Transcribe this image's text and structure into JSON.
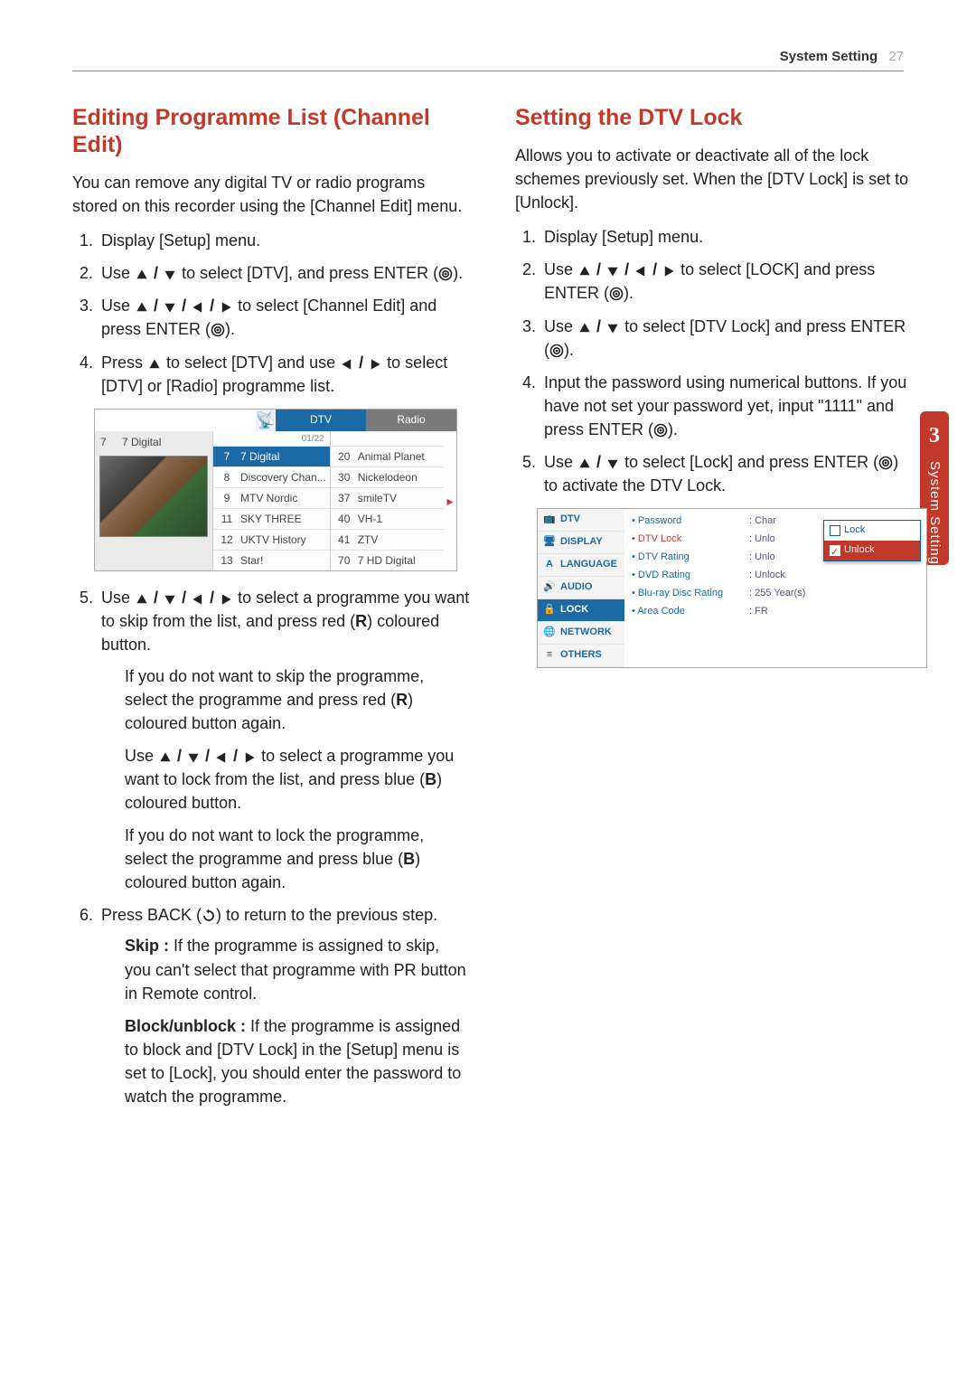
{
  "running_head": {
    "section": "System Setting",
    "page": "27"
  },
  "side_tab": {
    "num": "3",
    "label": "System Setting"
  },
  "left": {
    "title": "Editing Programme List (Channel Edit)",
    "intro": "You can remove any digital TV or radio programs stored on this recorder using the [Channel Edit] menu.",
    "steps_a": [
      "Display [Setup] menu.",
      "Use [UD] to select [DTV], and press ENTER ([ENTER]).",
      "Use [UDLR] to select [Channel Edit] and press ENTER ([ENTER]).",
      "Press [UP] to select [DTV] and use [LR] to select [DTV] or [Radio] programme list."
    ],
    "shot": {
      "tab_dtv": "DTV",
      "tab_radio": "Radio",
      "cur_num": "7",
      "cur_name": "7 Digital",
      "page_indicator": "01/22",
      "left_col": [
        {
          "n": "7",
          "name": "7 Digital",
          "sel": true
        },
        {
          "n": "8",
          "name": "Discovery Chan..."
        },
        {
          "n": "9",
          "name": "MTV Nordic"
        },
        {
          "n": "11",
          "name": "SKY THREE"
        },
        {
          "n": "12",
          "name": "UKTV History"
        },
        {
          "n": "13",
          "name": "Star!"
        }
      ],
      "right_col": [
        {
          "n": "20",
          "name": "Animal Planet"
        },
        {
          "n": "30",
          "name": "Nickelodeon"
        },
        {
          "n": "37",
          "name": "smileTV"
        },
        {
          "n": "40",
          "name": "VH-1"
        },
        {
          "n": "41",
          "name": "ZTV"
        },
        {
          "n": "70",
          "name": "7 HD Digital"
        }
      ]
    },
    "step5": "Use [UDLR] to select a programme you want to skip from the list, and press red ([B]R[/B]) coloured  button.",
    "step5b": "If you do not want to skip the programme, select the programme and press red ([B]R[/B]) coloured  button again.",
    "step5c": "Use [UDLR] to select a programme you want to lock from the list, and press blue ([B]B[/B]) coloured button.",
    "step5d": "If you do not want to lock the programme, select the programme and press blue ([B]B[/B]) coloured  button again.",
    "step6": "Press BACK ([BACK]) to return to the previous step.",
    "skip_label": "Skip :",
    "skip_text": " If the programme is assigned to skip, you can't select that programme with PR button in Remote control.",
    "block_label": "Block/unblock :",
    "block_text": " If the programme is assigned to block and [DTV Lock] in the [Setup] menu is set to [Lock], you should enter the password to watch the programme."
  },
  "right": {
    "title": "Setting the DTV Lock",
    "intro": "Allows you to activate or deactivate all of the lock schemes previously set. When the [DTV Lock] is set to [Unlock].",
    "steps": [
      "Display [Setup] menu.",
      "Use [UDLR] to select [LOCK] and press ENTER ([ENTER]).",
      "Use [UD] to select [DTV Lock] and press ENTER ([ENTER]).",
      "Input the password using numerical buttons. If you have not set your password yet, input \"1111\" and press ENTER ([ENTER]).",
      "Use [UD] to select [Lock] and press ENTER ([ENTER]) to activate the DTV Lock."
    ],
    "shot": {
      "menu": [
        "DTV",
        "DISPLAY",
        "LANGUAGE",
        "AUDIO",
        "LOCK",
        "NETWORK",
        "OTHERS"
      ],
      "menu_sel": 4,
      "opts": [
        {
          "lbl": "Password",
          "val": ": Char"
        },
        {
          "lbl": "DTV Lock",
          "val": ": Unlo",
          "sel": true
        },
        {
          "lbl": "DTV Rating",
          "val": ": Unlo"
        },
        {
          "lbl": "DVD Rating",
          "val": ": Unlock"
        },
        {
          "lbl": "Blu-ray Disc Rating",
          "val": ": 255 Year(s)"
        },
        {
          "lbl": "Area Code",
          "val": ": FR"
        }
      ],
      "popup": [
        {
          "label": "Lock",
          "sel": false
        },
        {
          "label": "Unlock",
          "sel": true
        }
      ]
    }
  }
}
